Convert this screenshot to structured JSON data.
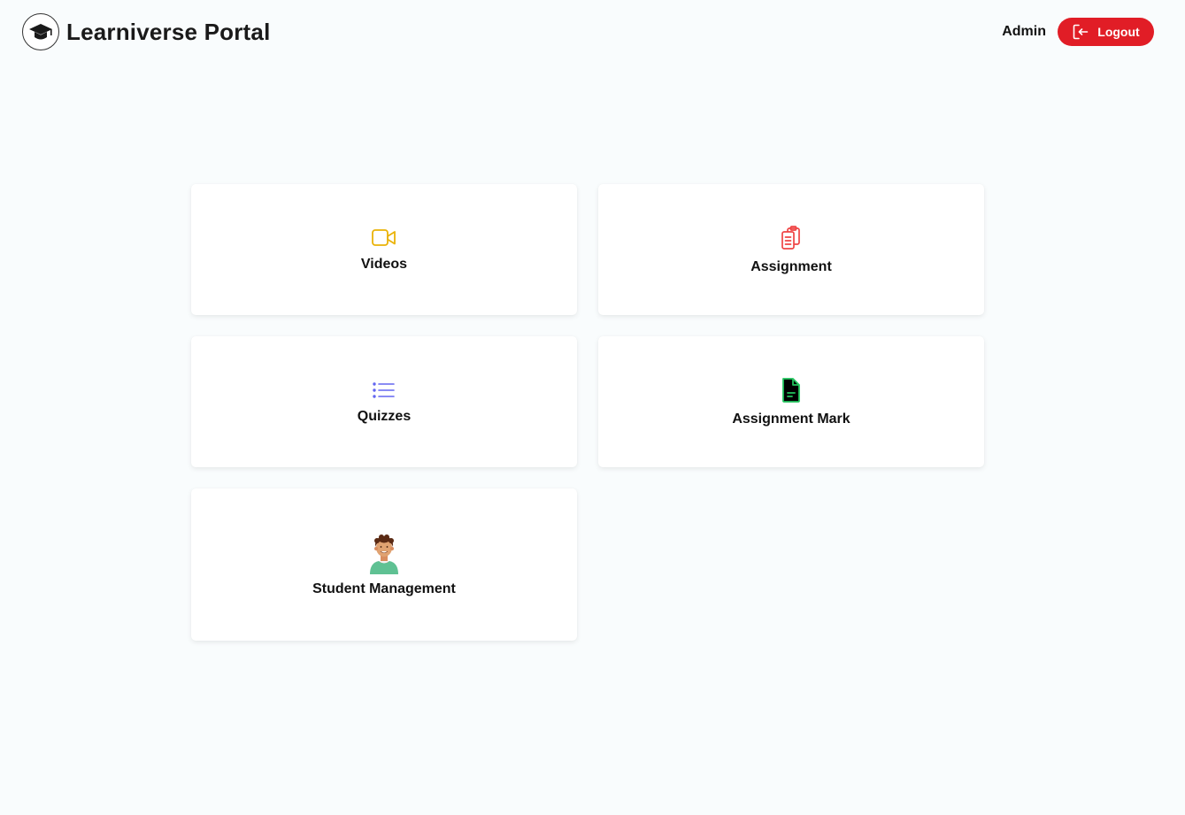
{
  "header": {
    "brand_title": "Learniverse Portal",
    "brand_icon": "graduation-cap-icon",
    "user_name": "Admin",
    "logout_label": "Logout",
    "logout_color": "#e11d26"
  },
  "dashboard": {
    "cards": [
      {
        "label": "Videos",
        "icon": "video-camera-icon",
        "icon_color": "#eab308"
      },
      {
        "label": "Assignment",
        "icon": "clipboard-copy-icon",
        "icon_color": "#ef4444"
      },
      {
        "label": "Quizzes",
        "icon": "list-icon",
        "icon_color": "#6366f1"
      },
      {
        "label": "Assignment Mark",
        "icon": "document-icon",
        "icon_color": "#22c55e"
      },
      {
        "label": "Student Management",
        "icon": "student-avatar-icon",
        "icon_color": "#5fc193"
      }
    ]
  }
}
